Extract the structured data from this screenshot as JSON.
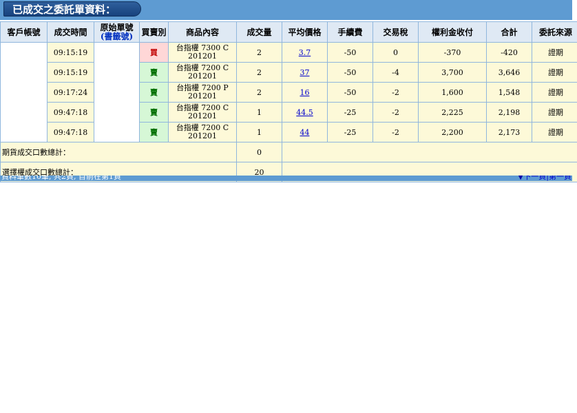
{
  "header": {
    "title": "已成交之委託單資料："
  },
  "columns": {
    "account": "客戶帳號",
    "time": "成交時間",
    "orig_order_main": "原始單號",
    "orig_order_sub": "(書籤號)",
    "side": "買賣別",
    "product": "商品內容",
    "qty": "成交量",
    "avg_price": "平均價格",
    "fee": "手續費",
    "tax": "交易稅",
    "premium": "權利金收付",
    "total": "合計",
    "source": "委託來源"
  },
  "rows": [
    {
      "time": "09:15:19",
      "side": "買",
      "side_type": "buy",
      "product_line1": "台指權 7300 C",
      "product_line2": "201201",
      "qty": "2",
      "avg_price": "3.7",
      "fee": "-50",
      "tax": "0",
      "premium": "-370",
      "total": "-420",
      "source": "證期"
    },
    {
      "time": "09:15:19",
      "side": "賣",
      "side_type": "sell",
      "product_line1": "台指權 7200 C",
      "product_line2": "201201",
      "qty": "2",
      "avg_price": "37",
      "fee": "-50",
      "tax": "-4",
      "premium": "3,700",
      "total": "3,646",
      "source": "證期"
    },
    {
      "time": "09:17:24",
      "side": "賣",
      "side_type": "sell",
      "product_line1": "台指權 7200 P",
      "product_line2": "201201",
      "qty": "2",
      "avg_price": "16",
      "fee": "-50",
      "tax": "-2",
      "premium": "1,600",
      "total": "1,548",
      "source": "證期"
    },
    {
      "time": "09:47:18",
      "side": "賣",
      "side_type": "sell",
      "product_line1": "台指權 7200 C",
      "product_line2": "201201",
      "qty": "1",
      "avg_price": "44.5",
      "fee": "-25",
      "tax": "-2",
      "premium": "2,225",
      "total": "2,198",
      "source": "證期"
    },
    {
      "time": "09:47:18",
      "side": "賣",
      "side_type": "sell",
      "product_line1": "台指權 7200 C",
      "product_line2": "201201",
      "qty": "1",
      "avg_price": "44",
      "fee": "-25",
      "tax": "-2",
      "premium": "2,200",
      "total": "2,173",
      "source": "證期"
    }
  ],
  "summary": {
    "futures_label": "期貨成交口數總計：",
    "futures_value": "0",
    "options_label": "選擇權成交口數總計：",
    "options_value": "20"
  },
  "footer": {
    "info": "資料筆數10筆, 共2頁, 目前在第1頁",
    "arrow": "▼",
    "next_page": "下一頁",
    "separator": "|",
    "first_page": "第一頁"
  },
  "colors": {
    "bar": "#5e9bd2",
    "header_bg": "#dfe9f4",
    "cell_bg": "#fdf9d8",
    "buy_bg": "#ffd7d7",
    "sell_bg": "#d6f7d6"
  }
}
